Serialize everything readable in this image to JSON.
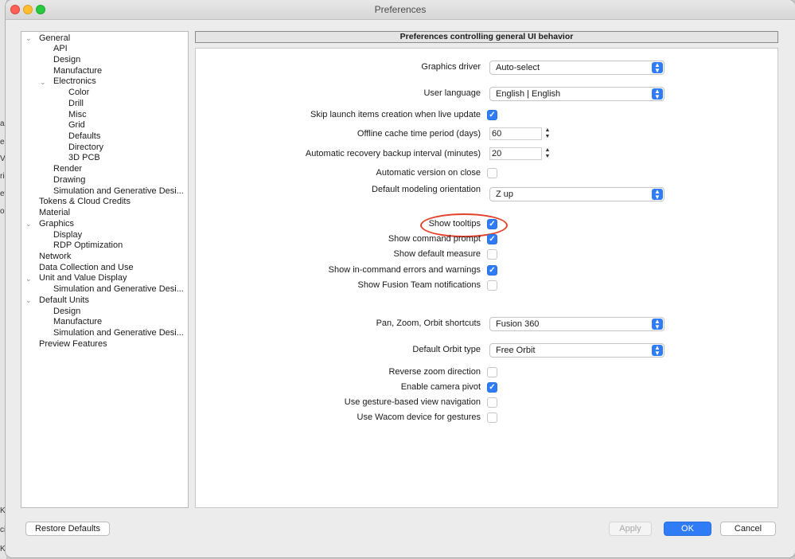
{
  "window": {
    "title": "Preferences"
  },
  "background_fragments": [
    "a",
    "e",
    "V",
    "rig",
    "et",
    "on",
    "K]",
    "ci",
    "K]"
  ],
  "tree": {
    "items": [
      {
        "label": "General",
        "expanded": true
      },
      {
        "label": "API"
      },
      {
        "label": "Design"
      },
      {
        "label": "Manufacture"
      },
      {
        "label": "Electronics",
        "expanded": true
      },
      {
        "label": "Color"
      },
      {
        "label": "Drill"
      },
      {
        "label": "Misc"
      },
      {
        "label": "Grid"
      },
      {
        "label": "Defaults"
      },
      {
        "label": "Directory"
      },
      {
        "label": "3D PCB"
      },
      {
        "label": "Render"
      },
      {
        "label": "Drawing"
      },
      {
        "label": "Simulation and Generative Desi..."
      },
      {
        "label": "Tokens & Cloud Credits"
      },
      {
        "label": "Material"
      },
      {
        "label": "Graphics",
        "expanded": true
      },
      {
        "label": "Display"
      },
      {
        "label": "RDP Optimization"
      },
      {
        "label": "Network"
      },
      {
        "label": "Data Collection and Use"
      },
      {
        "label": "Unit and Value Display",
        "expanded": true
      },
      {
        "label": "Simulation and Generative Desi..."
      },
      {
        "label": "Default Units",
        "expanded": true
      },
      {
        "label": "Design"
      },
      {
        "label": "Manufacture"
      },
      {
        "label": "Simulation and Generative Desi..."
      },
      {
        "label": "Preview Features"
      }
    ]
  },
  "panel": {
    "header": "Preferences controlling general UI behavior",
    "graphics_driver": {
      "label": "Graphics driver",
      "value": "Auto-select"
    },
    "user_language": {
      "label": "User language",
      "value": "English | English"
    },
    "skip_launch": {
      "label": "Skip launch items creation when live update",
      "checked": true
    },
    "offline_cache": {
      "label": "Offline cache time period (days)",
      "value": "60"
    },
    "recovery_backup": {
      "label": "Automatic recovery backup interval (minutes)",
      "value": "20"
    },
    "auto_version": {
      "label": "Automatic version on close",
      "checked": false
    },
    "modeling_orientation": {
      "label": "Default modeling orientation",
      "value": "Z up"
    },
    "show_tooltips": {
      "label": "Show tooltips",
      "checked": true
    },
    "show_command_prompt": {
      "label": "Show command prompt",
      "checked": true
    },
    "show_default_measure": {
      "label": "Show default measure",
      "checked": false
    },
    "show_incommand_errors": {
      "label": "Show in-command errors and warnings",
      "checked": true
    },
    "show_fusion_team": {
      "label": "Show Fusion Team notifications",
      "checked": false
    },
    "pan_zoom_orbit": {
      "label": "Pan, Zoom, Orbit shortcuts",
      "value": "Fusion 360"
    },
    "orbit_type": {
      "label": "Default Orbit type",
      "value": "Free Orbit"
    },
    "reverse_zoom": {
      "label": "Reverse zoom direction",
      "checked": false
    },
    "camera_pivot": {
      "label": "Enable camera pivot",
      "checked": true
    },
    "gesture_nav": {
      "label": "Use gesture-based view navigation",
      "checked": false
    },
    "wacom": {
      "label": "Use Wacom device for gestures",
      "checked": false
    }
  },
  "buttons": {
    "restore": "Restore Defaults",
    "apply": "Apply",
    "ok": "OK",
    "cancel": "Cancel"
  },
  "colors": {
    "accent": "#2f7cf6",
    "highlight": "#e3402a"
  }
}
